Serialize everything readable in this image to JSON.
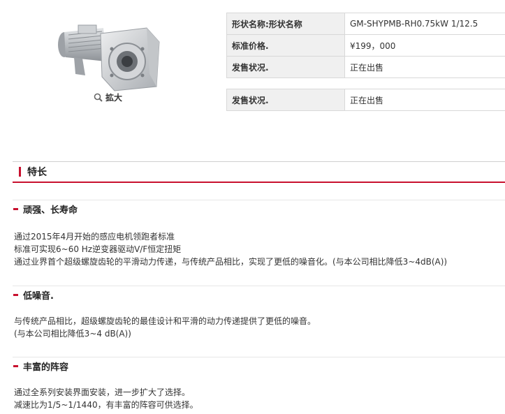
{
  "product": {
    "image_name": "gearmotor-image",
    "zoom_label": "拡大"
  },
  "spec_table_1": {
    "rows": [
      {
        "label": "形状名称:形状名称",
        "value": "GM-SHYPMB-RH0.75kW 1/12.5"
      },
      {
        "label": "标准价格.",
        "value": "¥199，000"
      },
      {
        "label": "发售状况.",
        "value": "正在出售"
      }
    ]
  },
  "spec_table_2": {
    "rows": [
      {
        "label": "发售状况.",
        "value": "正在出售"
      }
    ]
  },
  "features_section": {
    "title": "特长",
    "items": [
      {
        "title": "顽强、长寿命",
        "lines": [
          "通过2015年4月开始的感应电机领跑者标准",
          "标准可实现6~60 Hz逆变器驱动V/F恒定扭矩",
          "通过业界首个超级螺旋齿轮的平滑动力传递，与传统产品相比，实现了更低的噪音化。(与本公司相比降低3~4dB(A))"
        ]
      },
      {
        "title": "低噪音.",
        "lines": [
          "与传统产品相比，超级螺旋齿轮的最佳设计和平滑的动力传递提供了更低的噪音。",
          "(与本公司相比降低3~4 dB(A))"
        ]
      },
      {
        "title": "丰富的阵容",
        "lines": [
          "通过全系列安装界面安装，进一步扩大了选择。",
          "减速比为1/5~1/1440，有丰富的阵容可供选择。"
        ]
      }
    ]
  },
  "colors": {
    "accent": "#c8102e",
    "table_header_bg": "#f0f0f0",
    "border": "#d8d8d8"
  }
}
